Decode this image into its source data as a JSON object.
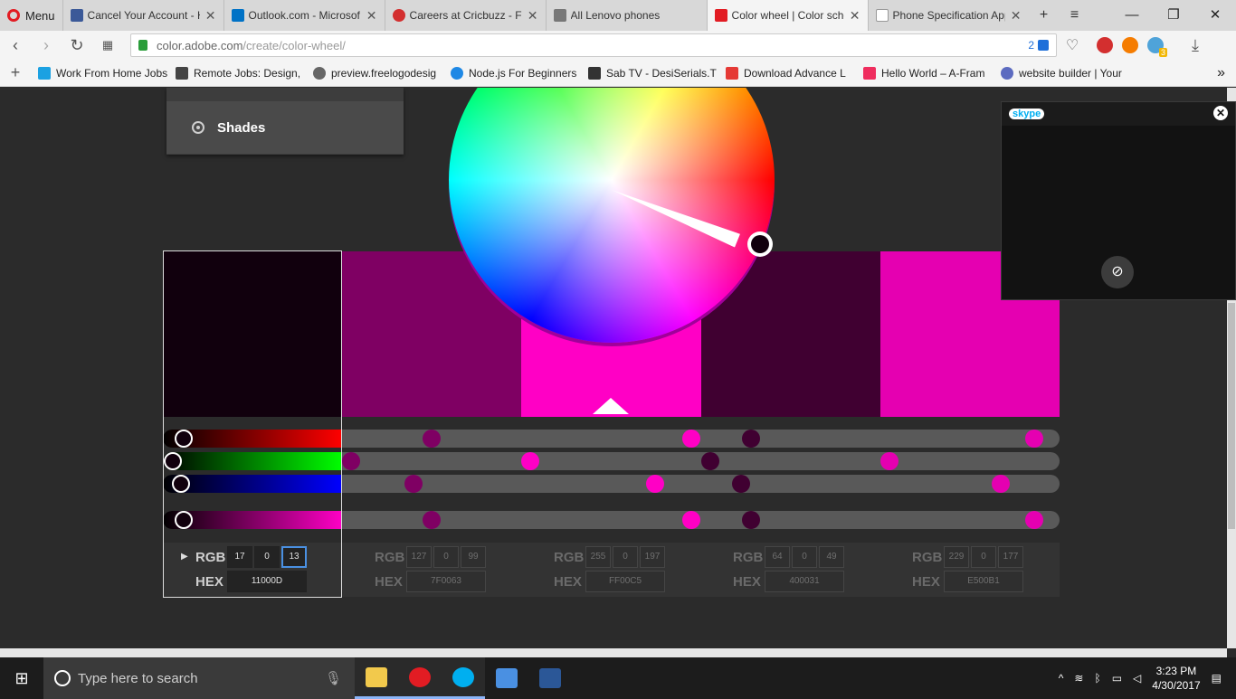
{
  "browser": {
    "menu_label": "Menu",
    "tabs": [
      {
        "title": "Cancel Your Account - H",
        "color": "#3b5998"
      },
      {
        "title": "Outlook.com - Microsof",
        "color": "#0072c6"
      },
      {
        "title": "Careers at Cricbuzz - Fr",
        "color": "#d32f2f"
      },
      {
        "title": "All Lenovo phones",
        "color": "#777777"
      },
      {
        "title": "Color wheel | Color sche",
        "color": "#e21c23"
      },
      {
        "title": "Phone Specification App",
        "color": "#999999"
      }
    ],
    "url_host": "color.adobe.com",
    "url_path": "/create/color-wheel/",
    "url_badge": "2",
    "ext_badge": "3",
    "bookmarks": [
      {
        "title": "Work From Home Jobs",
        "color": "#1ba1e2"
      },
      {
        "title": "Remote Jobs: Design,",
        "color": "#444444"
      },
      {
        "title": "preview.freelogodesig",
        "color": "#666666"
      },
      {
        "title": "Node.js For Beginners",
        "color": "#1e88e5"
      },
      {
        "title": "Sab TV - DesiSerials.T",
        "color": "#333333"
      },
      {
        "title": "Download Advance L",
        "color": "#e53935"
      },
      {
        "title": "Hello World – A-Fram",
        "color": "#ef2d5e"
      },
      {
        "title": "website builder | Your",
        "color": "#5c6bc0"
      }
    ]
  },
  "color_rule": {
    "option_label": "Shades"
  },
  "swatches": [
    {
      "name": "selected",
      "hex_color": "#11000d"
    },
    {
      "name": "s2",
      "hex_color": "#7f0063"
    },
    {
      "name": "s3",
      "hex_color": "#ff00c5"
    },
    {
      "name": "s4",
      "hex_color": "#400031"
    },
    {
      "name": "s5",
      "hex_color": "#e500b1"
    }
  ],
  "colors": [
    {
      "rgb_label": "RGB",
      "hex_label": "HEX",
      "r": "17",
      "g": "0",
      "b": "13",
      "hex": "11000D"
    },
    {
      "rgb_label": "RGB",
      "hex_label": "HEX",
      "r": "127",
      "g": "0",
      "b": "99",
      "hex": "7F0063"
    },
    {
      "rgb_label": "RGB",
      "hex_label": "HEX",
      "r": "255",
      "g": "0",
      "b": "197",
      "hex": "FF00C5"
    },
    {
      "rgb_label": "RGB",
      "hex_label": "HEX",
      "r": "64",
      "g": "0",
      "b": "49",
      "hex": "400031"
    },
    {
      "rgb_label": "RGB",
      "hex_label": "HEX",
      "r": "229",
      "g": "0",
      "b": "177",
      "hex": "E500B1"
    }
  ],
  "skype": {
    "title": "skype",
    "close_icon": "close-icon",
    "mic_icon": "mic-muted-icon"
  },
  "taskbar": {
    "search_placeholder": "Type here to search",
    "time": "3:23 PM",
    "date": "4/30/2017"
  }
}
